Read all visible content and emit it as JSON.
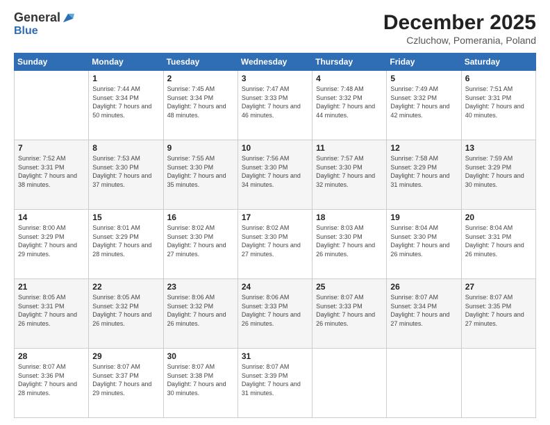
{
  "header": {
    "logo_line1": "General",
    "logo_line2": "Blue",
    "title": "December 2025",
    "subtitle": "Czluchow, Pomerania, Poland"
  },
  "days": [
    "Sunday",
    "Monday",
    "Tuesday",
    "Wednesday",
    "Thursday",
    "Friday",
    "Saturday"
  ],
  "weeks": [
    [
      {
        "day": "",
        "sunrise": "",
        "sunset": "",
        "daylight": ""
      },
      {
        "day": "1",
        "sunrise": "Sunrise: 7:44 AM",
        "sunset": "Sunset: 3:34 PM",
        "daylight": "Daylight: 7 hours and 50 minutes."
      },
      {
        "day": "2",
        "sunrise": "Sunrise: 7:45 AM",
        "sunset": "Sunset: 3:34 PM",
        "daylight": "Daylight: 7 hours and 48 minutes."
      },
      {
        "day": "3",
        "sunrise": "Sunrise: 7:47 AM",
        "sunset": "Sunset: 3:33 PM",
        "daylight": "Daylight: 7 hours and 46 minutes."
      },
      {
        "day": "4",
        "sunrise": "Sunrise: 7:48 AM",
        "sunset": "Sunset: 3:32 PM",
        "daylight": "Daylight: 7 hours and 44 minutes."
      },
      {
        "day": "5",
        "sunrise": "Sunrise: 7:49 AM",
        "sunset": "Sunset: 3:32 PM",
        "daylight": "Daylight: 7 hours and 42 minutes."
      },
      {
        "day": "6",
        "sunrise": "Sunrise: 7:51 AM",
        "sunset": "Sunset: 3:31 PM",
        "daylight": "Daylight: 7 hours and 40 minutes."
      }
    ],
    [
      {
        "day": "7",
        "sunrise": "Sunrise: 7:52 AM",
        "sunset": "Sunset: 3:31 PM",
        "daylight": "Daylight: 7 hours and 38 minutes."
      },
      {
        "day": "8",
        "sunrise": "Sunrise: 7:53 AM",
        "sunset": "Sunset: 3:30 PM",
        "daylight": "Daylight: 7 hours and 37 minutes."
      },
      {
        "day": "9",
        "sunrise": "Sunrise: 7:55 AM",
        "sunset": "Sunset: 3:30 PM",
        "daylight": "Daylight: 7 hours and 35 minutes."
      },
      {
        "day": "10",
        "sunrise": "Sunrise: 7:56 AM",
        "sunset": "Sunset: 3:30 PM",
        "daylight": "Daylight: 7 hours and 34 minutes."
      },
      {
        "day": "11",
        "sunrise": "Sunrise: 7:57 AM",
        "sunset": "Sunset: 3:30 PM",
        "daylight": "Daylight: 7 hours and 32 minutes."
      },
      {
        "day": "12",
        "sunrise": "Sunrise: 7:58 AM",
        "sunset": "Sunset: 3:29 PM",
        "daylight": "Daylight: 7 hours and 31 minutes."
      },
      {
        "day": "13",
        "sunrise": "Sunrise: 7:59 AM",
        "sunset": "Sunset: 3:29 PM",
        "daylight": "Daylight: 7 hours and 30 minutes."
      }
    ],
    [
      {
        "day": "14",
        "sunrise": "Sunrise: 8:00 AM",
        "sunset": "Sunset: 3:29 PM",
        "daylight": "Daylight: 7 hours and 29 minutes."
      },
      {
        "day": "15",
        "sunrise": "Sunrise: 8:01 AM",
        "sunset": "Sunset: 3:29 PM",
        "daylight": "Daylight: 7 hours and 28 minutes."
      },
      {
        "day": "16",
        "sunrise": "Sunrise: 8:02 AM",
        "sunset": "Sunset: 3:30 PM",
        "daylight": "Daylight: 7 hours and 27 minutes."
      },
      {
        "day": "17",
        "sunrise": "Sunrise: 8:02 AM",
        "sunset": "Sunset: 3:30 PM",
        "daylight": "Daylight: 7 hours and 27 minutes."
      },
      {
        "day": "18",
        "sunrise": "Sunrise: 8:03 AM",
        "sunset": "Sunset: 3:30 PM",
        "daylight": "Daylight: 7 hours and 26 minutes."
      },
      {
        "day": "19",
        "sunrise": "Sunrise: 8:04 AM",
        "sunset": "Sunset: 3:30 PM",
        "daylight": "Daylight: 7 hours and 26 minutes."
      },
      {
        "day": "20",
        "sunrise": "Sunrise: 8:04 AM",
        "sunset": "Sunset: 3:31 PM",
        "daylight": "Daylight: 7 hours and 26 minutes."
      }
    ],
    [
      {
        "day": "21",
        "sunrise": "Sunrise: 8:05 AM",
        "sunset": "Sunset: 3:31 PM",
        "daylight": "Daylight: 7 hours and 26 minutes."
      },
      {
        "day": "22",
        "sunrise": "Sunrise: 8:05 AM",
        "sunset": "Sunset: 3:32 PM",
        "daylight": "Daylight: 7 hours and 26 minutes."
      },
      {
        "day": "23",
        "sunrise": "Sunrise: 8:06 AM",
        "sunset": "Sunset: 3:32 PM",
        "daylight": "Daylight: 7 hours and 26 minutes."
      },
      {
        "day": "24",
        "sunrise": "Sunrise: 8:06 AM",
        "sunset": "Sunset: 3:33 PM",
        "daylight": "Daylight: 7 hours and 26 minutes."
      },
      {
        "day": "25",
        "sunrise": "Sunrise: 8:07 AM",
        "sunset": "Sunset: 3:33 PM",
        "daylight": "Daylight: 7 hours and 26 minutes."
      },
      {
        "day": "26",
        "sunrise": "Sunrise: 8:07 AM",
        "sunset": "Sunset: 3:34 PM",
        "daylight": "Daylight: 7 hours and 27 minutes."
      },
      {
        "day": "27",
        "sunrise": "Sunrise: 8:07 AM",
        "sunset": "Sunset: 3:35 PM",
        "daylight": "Daylight: 7 hours and 27 minutes."
      }
    ],
    [
      {
        "day": "28",
        "sunrise": "Sunrise: 8:07 AM",
        "sunset": "Sunset: 3:36 PM",
        "daylight": "Daylight: 7 hours and 28 minutes."
      },
      {
        "day": "29",
        "sunrise": "Sunrise: 8:07 AM",
        "sunset": "Sunset: 3:37 PM",
        "daylight": "Daylight: 7 hours and 29 minutes."
      },
      {
        "day": "30",
        "sunrise": "Sunrise: 8:07 AM",
        "sunset": "Sunset: 3:38 PM",
        "daylight": "Daylight: 7 hours and 30 minutes."
      },
      {
        "day": "31",
        "sunrise": "Sunrise: 8:07 AM",
        "sunset": "Sunset: 3:39 PM",
        "daylight": "Daylight: 7 hours and 31 minutes."
      },
      {
        "day": "",
        "sunrise": "",
        "sunset": "",
        "daylight": ""
      },
      {
        "day": "",
        "sunrise": "",
        "sunset": "",
        "daylight": ""
      },
      {
        "day": "",
        "sunrise": "",
        "sunset": "",
        "daylight": ""
      }
    ]
  ]
}
